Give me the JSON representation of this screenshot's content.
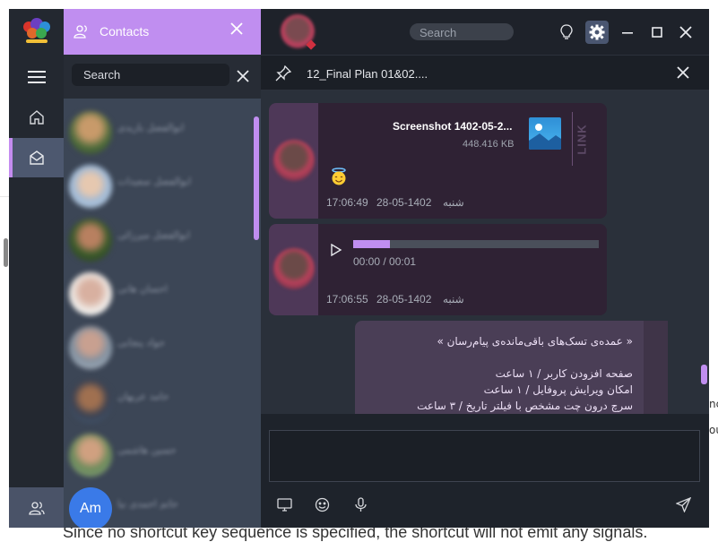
{
  "background": {
    "bottom_text": "Since no shortcut key sequence is specified, the shortcut will not emit any signals.",
    "right_text_1": "nc",
    "right_text_2": "ou"
  },
  "nav": {
    "items": [
      {
        "icon": "menu-icon"
      },
      {
        "icon": "home-icon"
      },
      {
        "icon": "envelope-open-icon",
        "active": true
      }
    ],
    "bottom_icon": "contacts-icon"
  },
  "contacts": {
    "title": "Contacts",
    "search_placeholder": "Search",
    "items": [
      {
        "name": "ابوالفضل بازیدی"
      },
      {
        "name": "ابوالفضل سعیدات"
      },
      {
        "name": "ابوالفضل میرزائی"
      },
      {
        "name": "احسان هانی"
      },
      {
        "name": "جواد پنجابی"
      },
      {
        "name": "حامد عربهان"
      },
      {
        "name": "حسین هاشمی"
      },
      {
        "name": "حاتم احمدی نیا"
      }
    ],
    "last_avatar_initials": "Am"
  },
  "topbar": {
    "search_placeholder": "Search"
  },
  "pinned": {
    "text": "12_Final Plan 01&02...."
  },
  "messages": {
    "file_message": {
      "file_name": "Screenshot 1402-05-2...",
      "file_size": "448.416 KB",
      "link_label": "LINK",
      "emoji": "😇",
      "time": "17:06:49",
      "date": "28-05-1402",
      "weekday": "شنبه"
    },
    "audio_message": {
      "progress": 0.15,
      "audio_time": "00:00 / 00:01",
      "time": "17:06:55",
      "date": "28-05-1402",
      "weekday": "شنبه"
    },
    "text_message": {
      "text": "« عمده‌ی تسک‌های باقی‌مانده‌ی پیام‌رسان »\n\nصفحه افزودن کاربر / ۱ ساعت\nامکان ویرایش پروفایل / ۱ ساعت\nسرچ درون چت مشخص با فیلتر تاریخ / ۳ ساعت\nادغام پیام‌رسان جدید با مکانیزم برای افزایش سرعت /"
    }
  },
  "colors": {
    "accent": "#c08ef0",
    "bubble": "#2f2234"
  }
}
